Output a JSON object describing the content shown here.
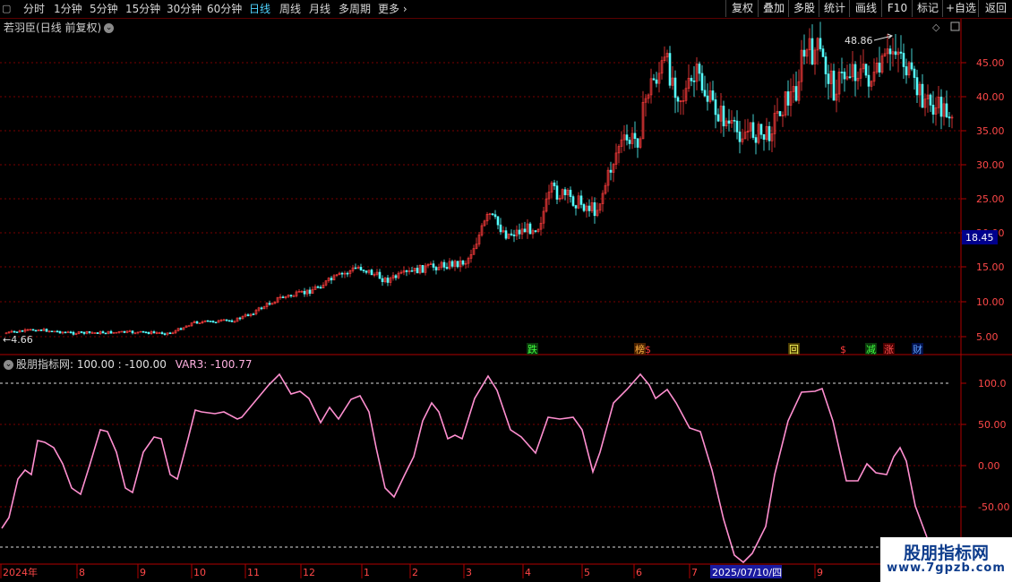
{
  "toolbar": {
    "periods": [
      "分时",
      "1分钟",
      "5分钟",
      "15分钟",
      "30分钟",
      "60分钟",
      "日线",
      "周线",
      "月线",
      "多周期"
    ],
    "active_index": 6,
    "more_label": "更多",
    "right_buttons": [
      "复权",
      "叠加",
      "多股",
      "统计",
      "画线",
      "F10",
      "标记",
      "+自选",
      "返回"
    ]
  },
  "stock": {
    "name": "若羽臣",
    "title_suffix": "(日线 前复权)",
    "high_label": "48.86",
    "low_label": "4.66",
    "current_price": "18.45",
    "price_ticks": [
      "45.00",
      "40.00",
      "35.00",
      "30.00",
      "25.00",
      "20.00",
      "15.00",
      "10.00",
      "5.00"
    ],
    "markers": [
      "跌",
      "榜",
      "$",
      "回",
      "$",
      "减",
      "涨",
      "财"
    ]
  },
  "indicator": {
    "name": "股朋指标网",
    "values_text": ": 100.00 : -100.00",
    "var3_label": "VAR3: -100.77",
    "ticks": [
      "100.0",
      "50.00",
      "0.00",
      "-50.00"
    ]
  },
  "timeline": {
    "labels": [
      "2024年",
      "8",
      "9",
      "10",
      "11",
      "12",
      "1",
      "2",
      "3",
      "4",
      "5",
      "6",
      "7",
      "9"
    ],
    "cursor_date": "2025/07/10/四"
  },
  "watermark": {
    "line1": "股朋指标网",
    "line2": "www.7gpzb.com"
  },
  "colors": {
    "up": "#ff3c3c",
    "down": "#54ffff",
    "indicator_line": "#ff8fd0",
    "grid": "#7a0000",
    "axis": "#b00000"
  }
}
